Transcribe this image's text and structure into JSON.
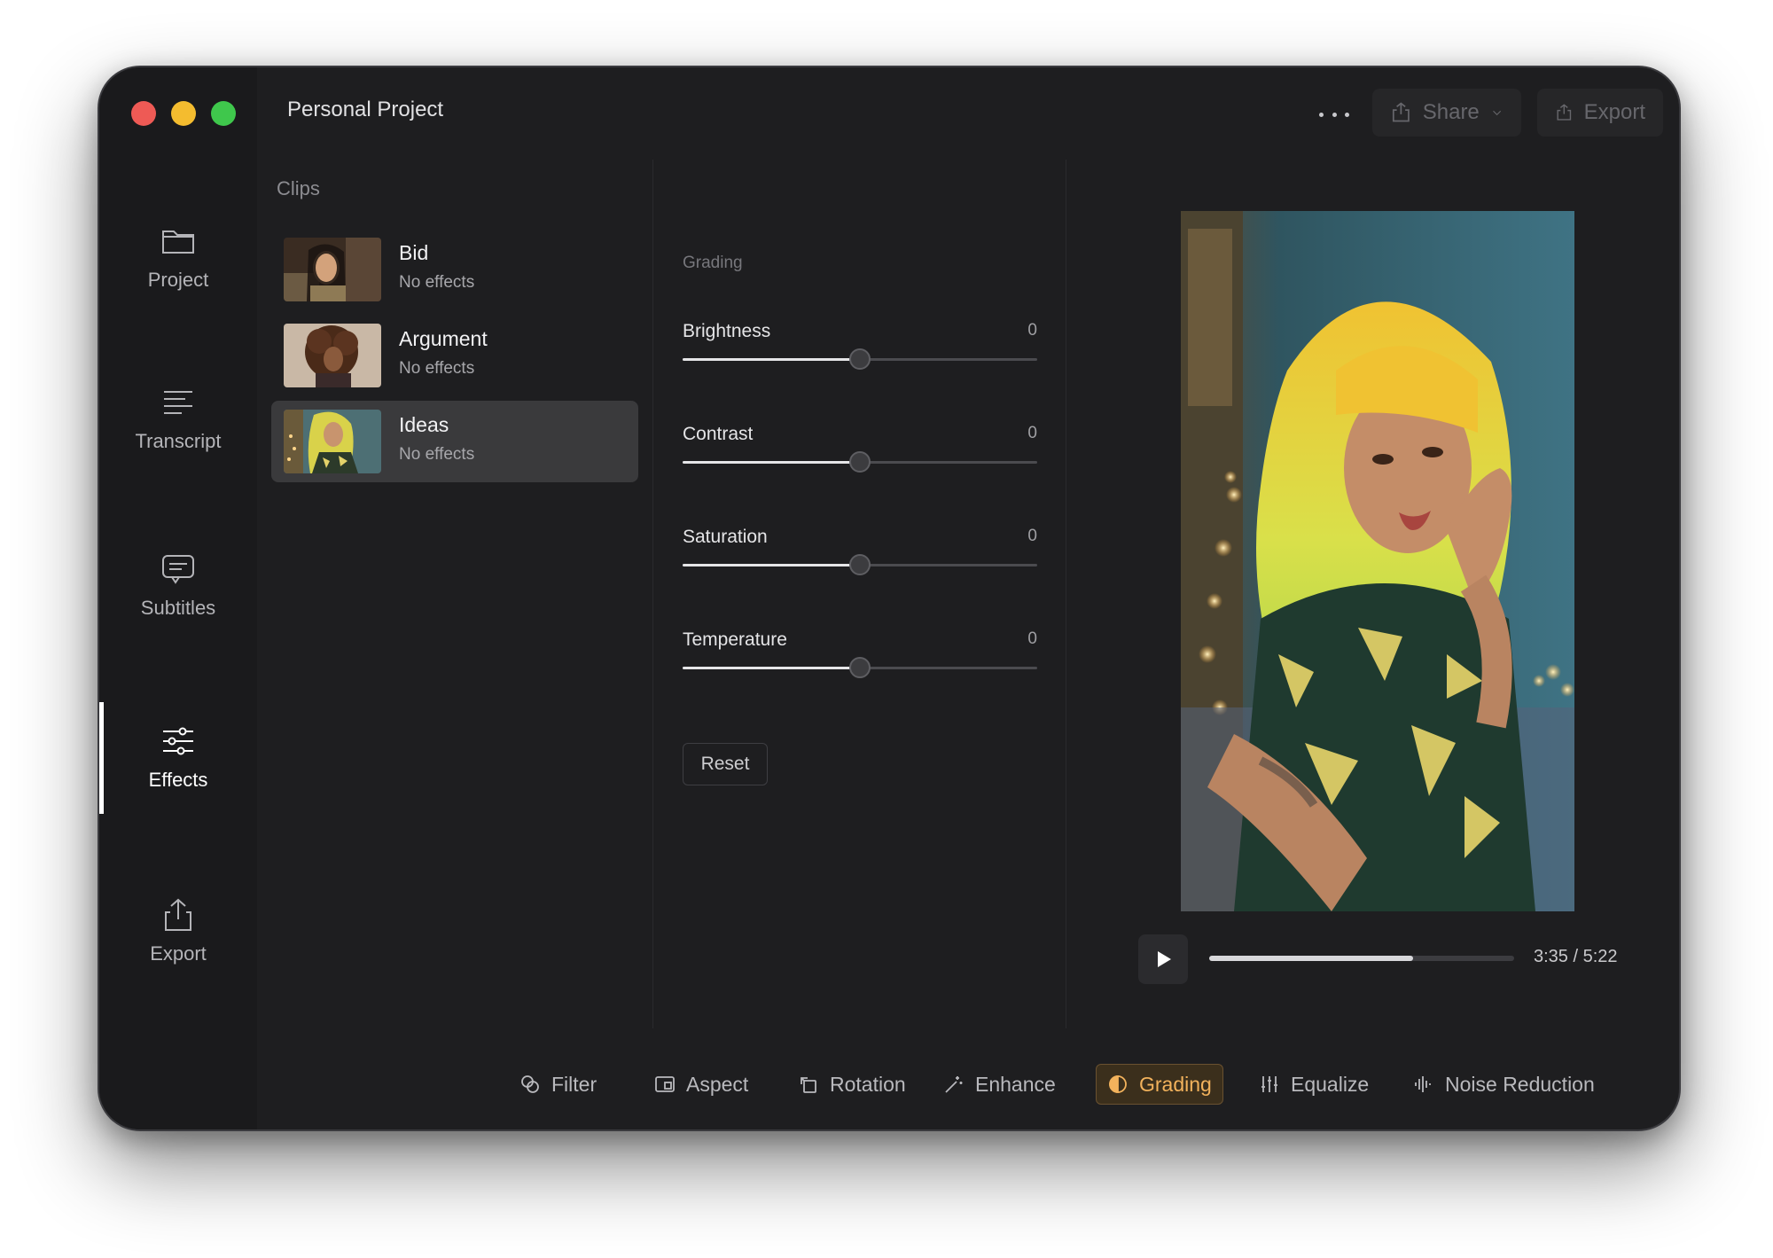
{
  "window": {
    "title": "Personal Project"
  },
  "header": {
    "share_label": "Share",
    "export_label": "Export"
  },
  "sidebar": {
    "items": [
      {
        "label": "Project",
        "icon": "folder-icon"
      },
      {
        "label": "Transcript",
        "icon": "text-lines-icon"
      },
      {
        "label": "Subtitles",
        "icon": "speech-bubble-icon"
      },
      {
        "label": "Effects",
        "icon": "sliders-icon"
      },
      {
        "label": "Export",
        "icon": "share-icon"
      }
    ],
    "active": "Effects"
  },
  "clips": {
    "heading": "Clips",
    "items": [
      {
        "name": "Bid",
        "status": "No effects"
      },
      {
        "name": "Argument",
        "status": "No effects"
      },
      {
        "name": "Ideas",
        "status": "No effects"
      }
    ],
    "selected": "Ideas"
  },
  "grading": {
    "heading": "Grading",
    "sliders": [
      {
        "label": "Brightness",
        "value": "0",
        "position_fraction": 0.5
      },
      {
        "label": "Contrast",
        "value": "0",
        "position_fraction": 0.5
      },
      {
        "label": "Saturation",
        "value": "0",
        "position_fraction": 0.5
      },
      {
        "label": "Temperature",
        "value": "0",
        "position_fraction": 0.5
      }
    ],
    "reset_label": "Reset"
  },
  "player": {
    "time": "3:35 / 5:22",
    "progress_fraction": 0.67
  },
  "toolbar": {
    "items": [
      {
        "label": "Filter",
        "icon": "filter-icon"
      },
      {
        "label": "Aspect",
        "icon": "aspect-icon"
      },
      {
        "label": "Rotation",
        "icon": "rotation-icon"
      },
      {
        "label": "Enhance",
        "icon": "magic-wand-icon"
      },
      {
        "label": "Grading",
        "icon": "half-circle-icon"
      },
      {
        "label": "Equalize",
        "icon": "equalizer-icon"
      },
      {
        "label": "Noise Reduction",
        "icon": "waveform-icon"
      }
    ],
    "active": "Grading"
  },
  "colors": {
    "accent": "#f2b25c",
    "window_bg": "#1e1e20",
    "sidebar_bg": "#1a1a1c"
  }
}
